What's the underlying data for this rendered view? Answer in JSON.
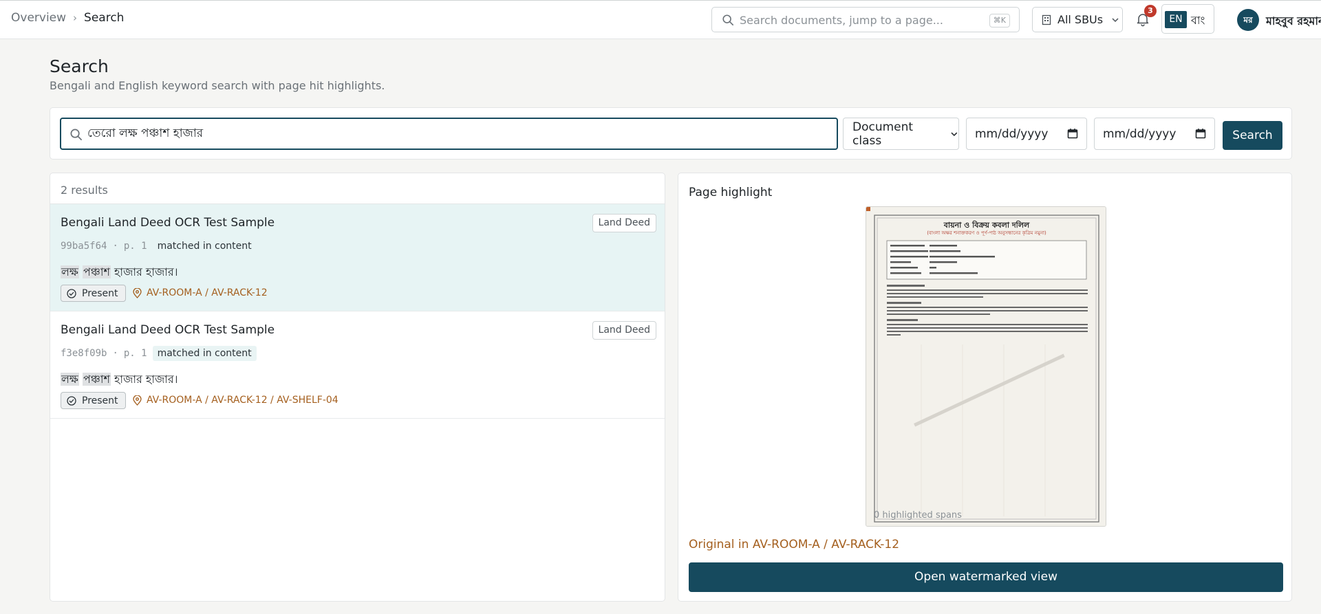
{
  "breadcrumb": {
    "parent": "Overview",
    "current": "Search"
  },
  "global_search": {
    "placeholder": "Search documents, jump to a page...",
    "shortcut": "⌘K"
  },
  "sbu_select": {
    "label": "All SBUs"
  },
  "notifications": {
    "count": "3"
  },
  "language": {
    "en": "EN",
    "bn": "বাং"
  },
  "user": {
    "initials": "মর",
    "name": "মাহবুব রহমান"
  },
  "page": {
    "title": "Search",
    "subtitle": "Bengali and English keyword search with page hit highlights."
  },
  "search": {
    "query": "তেরো লক্ষ পঞ্চাশ হাজার",
    "document_class": "Document class",
    "date_from": "mm/dd/yyyy",
    "date_to": "mm/dd/yyyy",
    "button": "Search"
  },
  "results": {
    "count_label": "2 results",
    "items": [
      {
        "title": "Bengali Land Deed OCR Test Sample",
        "doc_type": "Land Deed",
        "hash": "99ba5f64",
        "page": "p. 1",
        "match": "matched in content",
        "snippet_hl1": "লক্ষ",
        "snippet_hl2": "পঞ্চাশ",
        "snippet_rest": "হাজার হাজার।",
        "status": "Present",
        "location": "AV-ROOM-A / AV-RACK-12",
        "selected": true
      },
      {
        "title": "Bengali Land Deed OCR Test Sample",
        "doc_type": "Land Deed",
        "hash": "f3e8f09b",
        "page": "p. 1",
        "match": "matched in content",
        "snippet_hl1": "লক্ষ",
        "snippet_hl2": "পঞ্চাশ",
        "snippet_rest": "হাজার হাজার।",
        "status": "Present",
        "location": "AV-ROOM-A / AV-RACK-12 / AV-SHELF-04",
        "selected": false
      }
    ]
  },
  "preview": {
    "title": "Page highlight",
    "caption": "0 highlighted spans",
    "deed_title": "বায়না ও বিক্রয় কবলা দলিল",
    "deed_subtitle": "(বাংলা অক্ষর শনাক্তকরণ ও পূর্ণ-পাঠ অনুসন্ধানের কৃত্রিম নমুনা)",
    "original": "Original in AV-ROOM-A / AV-RACK-12",
    "button": "Open watermarked view"
  },
  "colors": {
    "accent": "#164a5e",
    "location": "#a45f1e",
    "selected_row": "#e7f4f4"
  }
}
